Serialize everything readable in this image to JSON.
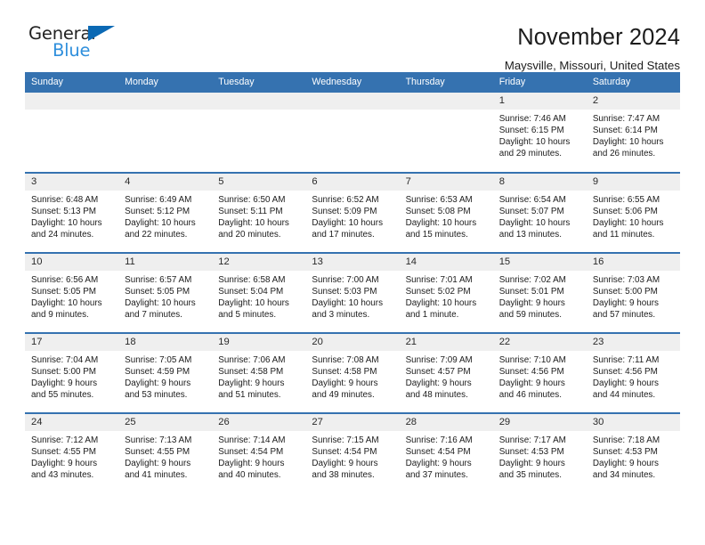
{
  "brand": {
    "name_top": "General",
    "name_bottom": "Blue",
    "triangle_color": "#0b69b4",
    "blue_text_color": "#2f8fdc"
  },
  "header": {
    "title": "November 2024",
    "subtitle": "Maysville, Missouri, United States",
    "accent_color": "#3572b0",
    "daynum_band_color": "#efefef"
  },
  "weekday_headers": [
    "Sunday",
    "Monday",
    "Tuesday",
    "Wednesday",
    "Thursday",
    "Friday",
    "Saturday"
  ],
  "weeks": [
    [
      {
        "day": "",
        "empty": true
      },
      {
        "day": "",
        "empty": true
      },
      {
        "day": "",
        "empty": true
      },
      {
        "day": "",
        "empty": true
      },
      {
        "day": "",
        "empty": true
      },
      {
        "day": "1",
        "sunrise": "Sunrise: 7:46 AM",
        "sunset": "Sunset: 6:15 PM",
        "daylight_1": "Daylight: 10 hours",
        "daylight_2": "and 29 minutes."
      },
      {
        "day": "2",
        "sunrise": "Sunrise: 7:47 AM",
        "sunset": "Sunset: 6:14 PM",
        "daylight_1": "Daylight: 10 hours",
        "daylight_2": "and 26 minutes."
      }
    ],
    [
      {
        "day": "3",
        "sunrise": "Sunrise: 6:48 AM",
        "sunset": "Sunset: 5:13 PM",
        "daylight_1": "Daylight: 10 hours",
        "daylight_2": "and 24 minutes."
      },
      {
        "day": "4",
        "sunrise": "Sunrise: 6:49 AM",
        "sunset": "Sunset: 5:12 PM",
        "daylight_1": "Daylight: 10 hours",
        "daylight_2": "and 22 minutes."
      },
      {
        "day": "5",
        "sunrise": "Sunrise: 6:50 AM",
        "sunset": "Sunset: 5:11 PM",
        "daylight_1": "Daylight: 10 hours",
        "daylight_2": "and 20 minutes."
      },
      {
        "day": "6",
        "sunrise": "Sunrise: 6:52 AM",
        "sunset": "Sunset: 5:09 PM",
        "daylight_1": "Daylight: 10 hours",
        "daylight_2": "and 17 minutes."
      },
      {
        "day": "7",
        "sunrise": "Sunrise: 6:53 AM",
        "sunset": "Sunset: 5:08 PM",
        "daylight_1": "Daylight: 10 hours",
        "daylight_2": "and 15 minutes."
      },
      {
        "day": "8",
        "sunrise": "Sunrise: 6:54 AM",
        "sunset": "Sunset: 5:07 PM",
        "daylight_1": "Daylight: 10 hours",
        "daylight_2": "and 13 minutes."
      },
      {
        "day": "9",
        "sunrise": "Sunrise: 6:55 AM",
        "sunset": "Sunset: 5:06 PM",
        "daylight_1": "Daylight: 10 hours",
        "daylight_2": "and 11 minutes."
      }
    ],
    [
      {
        "day": "10",
        "sunrise": "Sunrise: 6:56 AM",
        "sunset": "Sunset: 5:05 PM",
        "daylight_1": "Daylight: 10 hours",
        "daylight_2": "and 9 minutes."
      },
      {
        "day": "11",
        "sunrise": "Sunrise: 6:57 AM",
        "sunset": "Sunset: 5:05 PM",
        "daylight_1": "Daylight: 10 hours",
        "daylight_2": "and 7 minutes."
      },
      {
        "day": "12",
        "sunrise": "Sunrise: 6:58 AM",
        "sunset": "Sunset: 5:04 PM",
        "daylight_1": "Daylight: 10 hours",
        "daylight_2": "and 5 minutes."
      },
      {
        "day": "13",
        "sunrise": "Sunrise: 7:00 AM",
        "sunset": "Sunset: 5:03 PM",
        "daylight_1": "Daylight: 10 hours",
        "daylight_2": "and 3 minutes."
      },
      {
        "day": "14",
        "sunrise": "Sunrise: 7:01 AM",
        "sunset": "Sunset: 5:02 PM",
        "daylight_1": "Daylight: 10 hours",
        "daylight_2": "and 1 minute."
      },
      {
        "day": "15",
        "sunrise": "Sunrise: 7:02 AM",
        "sunset": "Sunset: 5:01 PM",
        "daylight_1": "Daylight: 9 hours",
        "daylight_2": "and 59 minutes."
      },
      {
        "day": "16",
        "sunrise": "Sunrise: 7:03 AM",
        "sunset": "Sunset: 5:00 PM",
        "daylight_1": "Daylight: 9 hours",
        "daylight_2": "and 57 minutes."
      }
    ],
    [
      {
        "day": "17",
        "sunrise": "Sunrise: 7:04 AM",
        "sunset": "Sunset: 5:00 PM",
        "daylight_1": "Daylight: 9 hours",
        "daylight_2": "and 55 minutes."
      },
      {
        "day": "18",
        "sunrise": "Sunrise: 7:05 AM",
        "sunset": "Sunset: 4:59 PM",
        "daylight_1": "Daylight: 9 hours",
        "daylight_2": "and 53 minutes."
      },
      {
        "day": "19",
        "sunrise": "Sunrise: 7:06 AM",
        "sunset": "Sunset: 4:58 PM",
        "daylight_1": "Daylight: 9 hours",
        "daylight_2": "and 51 minutes."
      },
      {
        "day": "20",
        "sunrise": "Sunrise: 7:08 AM",
        "sunset": "Sunset: 4:58 PM",
        "daylight_1": "Daylight: 9 hours",
        "daylight_2": "and 49 minutes."
      },
      {
        "day": "21",
        "sunrise": "Sunrise: 7:09 AM",
        "sunset": "Sunset: 4:57 PM",
        "daylight_1": "Daylight: 9 hours",
        "daylight_2": "and 48 minutes."
      },
      {
        "day": "22",
        "sunrise": "Sunrise: 7:10 AM",
        "sunset": "Sunset: 4:56 PM",
        "daylight_1": "Daylight: 9 hours",
        "daylight_2": "and 46 minutes."
      },
      {
        "day": "23",
        "sunrise": "Sunrise: 7:11 AM",
        "sunset": "Sunset: 4:56 PM",
        "daylight_1": "Daylight: 9 hours",
        "daylight_2": "and 44 minutes."
      }
    ],
    [
      {
        "day": "24",
        "sunrise": "Sunrise: 7:12 AM",
        "sunset": "Sunset: 4:55 PM",
        "daylight_1": "Daylight: 9 hours",
        "daylight_2": "and 43 minutes."
      },
      {
        "day": "25",
        "sunrise": "Sunrise: 7:13 AM",
        "sunset": "Sunset: 4:55 PM",
        "daylight_1": "Daylight: 9 hours",
        "daylight_2": "and 41 minutes."
      },
      {
        "day": "26",
        "sunrise": "Sunrise: 7:14 AM",
        "sunset": "Sunset: 4:54 PM",
        "daylight_1": "Daylight: 9 hours",
        "daylight_2": "and 40 minutes."
      },
      {
        "day": "27",
        "sunrise": "Sunrise: 7:15 AM",
        "sunset": "Sunset: 4:54 PM",
        "daylight_1": "Daylight: 9 hours",
        "daylight_2": "and 38 minutes."
      },
      {
        "day": "28",
        "sunrise": "Sunrise: 7:16 AM",
        "sunset": "Sunset: 4:54 PM",
        "daylight_1": "Daylight: 9 hours",
        "daylight_2": "and 37 minutes."
      },
      {
        "day": "29",
        "sunrise": "Sunrise: 7:17 AM",
        "sunset": "Sunset: 4:53 PM",
        "daylight_1": "Daylight: 9 hours",
        "daylight_2": "and 35 minutes."
      },
      {
        "day": "30",
        "sunrise": "Sunrise: 7:18 AM",
        "sunset": "Sunset: 4:53 PM",
        "daylight_1": "Daylight: 9 hours",
        "daylight_2": "and 34 minutes."
      }
    ]
  ]
}
